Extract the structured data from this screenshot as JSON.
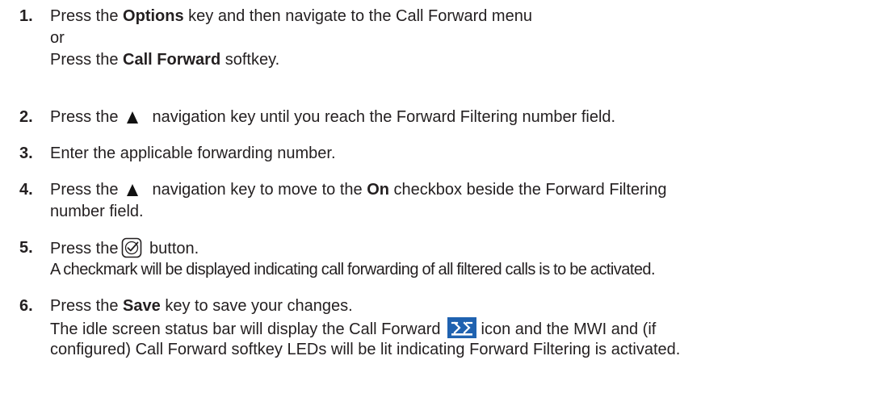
{
  "steps": [
    {
      "number": "1.",
      "lines": {
        "l1_pre": "Press the ",
        "l1_bold": "Options",
        "l1_post": " key and then navigate to the Call Forward menu",
        "l2": "or",
        "l3_pre": "Press the ",
        "l3_bold": "Call Forward",
        "l3_post": " softkey."
      }
    },
    {
      "number": "2.",
      "lines": {
        "pre": "Press the",
        "post": "navigation key until you reach the Forward Filtering number field."
      }
    },
    {
      "number": "3.",
      "lines": {
        "text": "Enter the applicable forwarding number."
      }
    },
    {
      "number": "4.",
      "lines": {
        "pre": "Press the",
        "mid": "navigation key to move to the ",
        "bold": "On",
        "post": " checkbox beside the Forward Filtering",
        "l2": "number field."
      }
    },
    {
      "number": "5.",
      "lines": {
        "pre": "Press the",
        "post": " button.",
        "l2": "A checkmark will be displayed indicating call forwarding of all filtered calls is to be activated."
      }
    },
    {
      "number": "6.",
      "lines": {
        "l1_pre": "Press the ",
        "l1_bold": "Save",
        "l1_post": " key to save your changes.",
        "l2_pre": "The idle screen status bar will display the Call Forward",
        "l2_post": "icon and the MWI and (if",
        "l3": "configured) Call Forward softkey LEDs will be lit indicating Forward Filtering is activated."
      }
    }
  ],
  "icons": {
    "navigation_key": "up-arrow-icon",
    "select_button": "checkmark-button-icon",
    "call_forward_status": "call-forward-icon"
  },
  "colors": {
    "text": "#231f20",
    "call_forward_icon_bg": "#1f62b0"
  }
}
